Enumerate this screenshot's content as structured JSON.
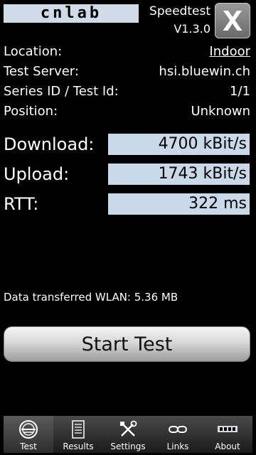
{
  "header": {
    "logo_text": "cnlab",
    "app_name": "Speedtest",
    "version": "V1.3.0",
    "close_glyph": "X"
  },
  "info": [
    {
      "label": "Location:",
      "value": "Indoor"
    },
    {
      "label": "Test Server:",
      "value": "hsi.bluewin.ch"
    },
    {
      "label": "Series ID / Test Id:",
      "value": "1/1"
    },
    {
      "label": "Position:",
      "value": "Unknown"
    }
  ],
  "metrics": [
    {
      "label": "Download:",
      "value": "4700 kBit/s"
    },
    {
      "label": "Upload:",
      "value": "1743 kBit/s"
    },
    {
      "label": "RTT:",
      "value": "322 ms"
    }
  ],
  "data_transferred": "Data transferred WLAN: 5.36 MB",
  "start_button_label": "Start Test",
  "tabs": [
    {
      "label": "Test",
      "icon": "speedometer-icon",
      "active": true
    },
    {
      "label": "Results",
      "icon": "document-icon",
      "active": false
    },
    {
      "label": "Settings",
      "icon": "tools-icon",
      "active": false
    },
    {
      "label": "Links",
      "icon": "chain-link-icon",
      "active": false
    },
    {
      "label": "About",
      "icon": "cnlab-logo-icon",
      "active": false
    }
  ],
  "colors": {
    "background": "#000000",
    "value_box": "#c9d9ea",
    "logo_bg": "#cfdbe8"
  }
}
